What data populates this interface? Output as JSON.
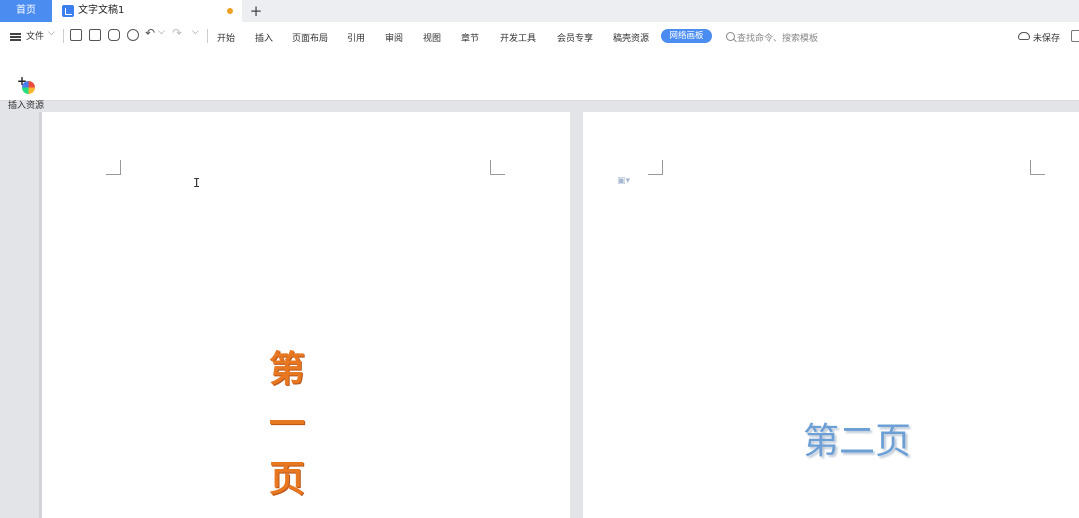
{
  "tabs": {
    "home": "首页",
    "document": "文字文稿1",
    "add": "+"
  },
  "toolbar": {
    "file": "文件",
    "menu": [
      "开始",
      "插入",
      "页面布局",
      "引用",
      "审阅",
      "视图",
      "章节",
      "开发工具",
      "会员专享",
      "稿壳资源"
    ],
    "highlight": "网络画板",
    "search": "查找命令、搜索模板",
    "unsaved": "未保存"
  },
  "ribbon": {
    "insert_resource": "插入资源"
  },
  "document": {
    "page1_lines": [
      "第",
      "一",
      "页"
    ],
    "page2_text": "第二页"
  },
  "colors": {
    "accent": "#4a8cf0",
    "page1_text": "#e87722",
    "page2_text": "#6b9fd6"
  }
}
